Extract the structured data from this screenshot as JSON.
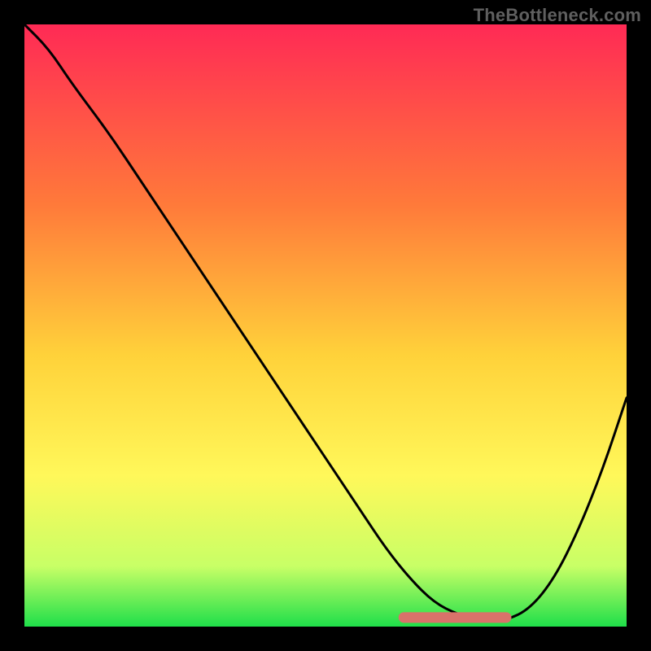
{
  "watermark": "TheBottleneck.com",
  "colors": {
    "frame": "#000000",
    "gradient_top": "#ff2a55",
    "gradient_mid_upper": "#ff7a3a",
    "gradient_mid": "#ffd23a",
    "gradient_mid_lower": "#fff85a",
    "gradient_lower": "#c8ff66",
    "gradient_bottom": "#1fdf4a",
    "curve": "#000000",
    "marker": "#d9726a"
  },
  "chart_data": {
    "type": "line",
    "title": "",
    "xlabel": "",
    "ylabel": "",
    "xlim": [
      0,
      100
    ],
    "ylim": [
      0,
      100
    ],
    "grid": false,
    "series": [
      {
        "name": "bottleneck-curve",
        "x": [
          0,
          4,
          8,
          14,
          20,
          26,
          32,
          38,
          44,
          50,
          56,
          60,
          64,
          68,
          72,
          76,
          80,
          84,
          88,
          92,
          96,
          100
        ],
        "values": [
          100,
          96,
          90,
          82,
          73,
          64,
          55,
          46,
          37,
          28,
          19,
          13,
          8,
          4,
          2,
          1,
          1,
          3,
          8,
          16,
          26,
          38
        ]
      }
    ],
    "markers": {
      "name": "highlight-band",
      "x_start": 63,
      "x_end": 80,
      "y": 1.5
    }
  }
}
